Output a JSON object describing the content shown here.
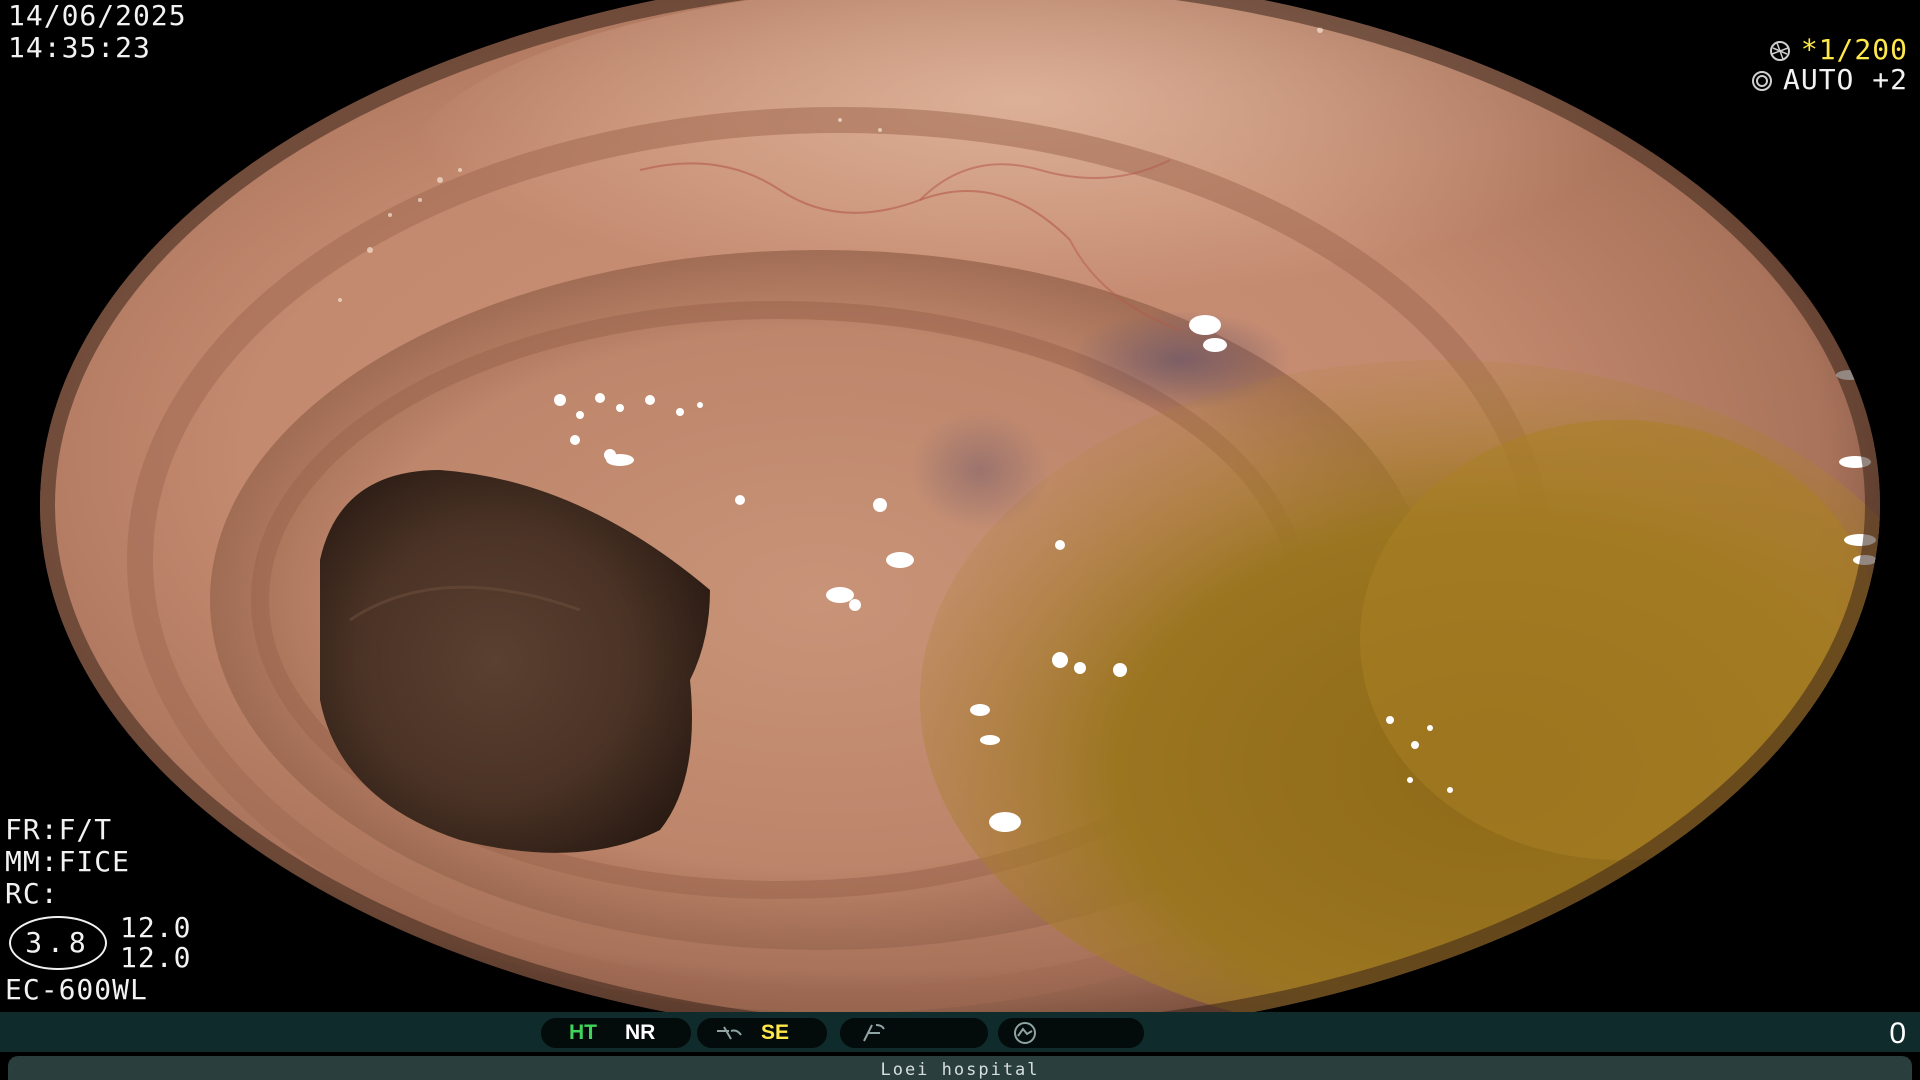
{
  "overlay": {
    "date": "14/06/2025",
    "time": "14:35:23",
    "shutter_star": "*",
    "shutter_value": "1/200",
    "iris_mode": "AUTO +2",
    "frame_mode": "FR:F/T",
    "mm_mode": "MM:FICE",
    "rc_label": "RC:",
    "zoom_circle": "3.8",
    "zoom_value_1": "12.0",
    "zoom_value_2": "12.0",
    "scope_model": "EC-600WL"
  },
  "status_bar": {
    "ht_label": "HT",
    "nr_label": "NR",
    "se_label": "SE",
    "counter": "0",
    "hospital": "Loei hospital"
  },
  "icons": {
    "shutter": "aperture-icon",
    "iris": "iris-ring-icon",
    "structure": "structure-enhance-icon",
    "freeze": "freeze-icon",
    "mode": "mode-ring-icon"
  },
  "colors": {
    "ht_green": "#3fd45a",
    "yellow": "#ffe94a",
    "status_bg": "#0f2b2b",
    "hospital_bg": "#2a3e3e"
  }
}
